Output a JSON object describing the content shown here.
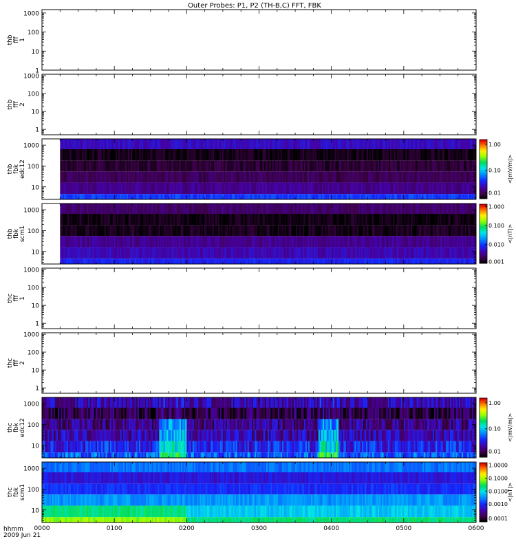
{
  "title": "Outer Probes: P1, P2 (TH-B,C) FFT, FBK",
  "colors": {
    "ink": "#000000"
  },
  "chart_data": [
    {
      "id": "thb-fff1",
      "type": "heatmap",
      "ylabel": [
        "thb",
        "fff",
        "1"
      ],
      "yscale": "log",
      "ylim": [
        1,
        1500
      ],
      "yticks": [
        1,
        10,
        100,
        1000
      ],
      "ytick_labels": [
        "1",
        "10",
        "100",
        "1000"
      ],
      "has_data": false,
      "colorbar": null
    },
    {
      "id": "thb-fff2",
      "type": "heatmap",
      "ylabel": [
        "thb",
        "fff",
        "2"
      ],
      "yscale": "log",
      "ylim": [
        0.5,
        1200
      ],
      "yticks": [
        1,
        10,
        100,
        1000
      ],
      "ytick_labels": [
        "1",
        "10",
        "100",
        "1000"
      ],
      "has_data": false,
      "colorbar": null
    },
    {
      "id": "thb-fbk-edc12",
      "type": "heatmap",
      "ylabel": [
        "thb",
        "fbk",
        "edc12"
      ],
      "yscale": "log",
      "ylim": [
        2.5,
        2000
      ],
      "yticks": [
        10,
        100,
        1000
      ],
      "ytick_labels": [
        "10",
        "100",
        "1000"
      ],
      "has_data": true,
      "data_start_hour": 0.25,
      "bands": [
        2048,
        512,
        128,
        32,
        8,
        2,
        2.5
      ],
      "band_levels": [
        0.22,
        0.03,
        0.06,
        0.1,
        0.16,
        0.32,
        0.62
      ],
      "colorbar": {
        "label": "<|mV/m|>",
        "ticks": [
          "1.00",
          "0.10",
          "0.01"
        ],
        "tick_pos": [
          0.92,
          0.48,
          0.1
        ]
      }
    },
    {
      "id": "thb-fbk-scm1",
      "type": "heatmap",
      "ylabel": [
        "thb",
        "fbk",
        "scm1"
      ],
      "yscale": "log",
      "ylim": [
        2.5,
        2000
      ],
      "yticks": [
        10,
        100,
        1000
      ],
      "ytick_labels": [
        "10",
        "100",
        "1000"
      ],
      "has_data": true,
      "data_start_hour": 0.25,
      "bands": [
        2048,
        512,
        128,
        32,
        8,
        2,
        2.5
      ],
      "band_levels": [
        0.12,
        0.02,
        0.03,
        0.16,
        0.2,
        0.28,
        0.5
      ],
      "colorbar": {
        "label": "<|nT|>",
        "ticks": [
          "1.000",
          "0.100",
          "0.010",
          "0.001"
        ],
        "tick_pos": [
          0.96,
          0.64,
          0.32,
          0.03
        ]
      }
    },
    {
      "id": "thc-fff1",
      "type": "heatmap",
      "ylabel": [
        "thc",
        "fff",
        "1"
      ],
      "yscale": "log",
      "ylim": [
        0.5,
        1200
      ],
      "yticks": [
        1,
        10,
        100,
        1000
      ],
      "ytick_labels": [
        "1",
        "10",
        "100",
        "1000"
      ],
      "has_data": false,
      "colorbar": null
    },
    {
      "id": "thc-fff2",
      "type": "heatmap",
      "ylabel": [
        "thc",
        "fff",
        "2"
      ],
      "yscale": "log",
      "ylim": [
        0.5,
        1200
      ],
      "yticks": [
        1,
        10,
        100,
        1000
      ],
      "ytick_labels": [
        "1",
        "10",
        "100",
        "1000"
      ],
      "has_data": false,
      "colorbar": null
    },
    {
      "id": "thc-fbk-edc12",
      "type": "heatmap",
      "ylabel": [
        "thc",
        "fbk",
        "edc12"
      ],
      "yscale": "log",
      "ylim": [
        2.5,
        2000
      ],
      "yticks": [
        10,
        100,
        1000
      ],
      "ytick_labels": [
        "10",
        "100",
        "1000"
      ],
      "has_data": true,
      "data_start_hour": 0,
      "bands": [
        2048,
        512,
        128,
        32,
        8,
        2,
        2.5
      ],
      "band_levels": [
        0.2,
        0.08,
        0.16,
        0.2,
        0.28,
        0.36,
        0.5
      ],
      "variability": 0.22,
      "colorbar": {
        "label": "<|mV/m|>",
        "ticks": [
          "1.00",
          "0.10",
          "0.01"
        ],
        "tick_pos": [
          0.92,
          0.48,
          0.1
        ]
      }
    },
    {
      "id": "thc-fbk-scm1",
      "type": "heatmap",
      "ylabel": [
        "thc",
        "fbk",
        "scm1"
      ],
      "yscale": "log",
      "ylim": [
        2.5,
        2000
      ],
      "yticks": [
        10,
        100,
        1000
      ],
      "ytick_labels": [
        "10",
        "100",
        "1000"
      ],
      "has_data": true,
      "data_start_hour": 0,
      "bands": [
        2048,
        512,
        128,
        32,
        8,
        2,
        2.5
      ],
      "band_levels": [
        0.38,
        0.25,
        0.3,
        0.42,
        0.48,
        0.6,
        0.7
      ],
      "colorbar": {
        "label": "<|nT|>",
        "ticks": [
          "1.0000",
          "0.1000",
          "0.0100",
          "0.0010",
          "0.0001"
        ],
        "tick_pos": [
          0.96,
          0.74,
          0.52,
          0.3,
          0.06
        ]
      }
    }
  ],
  "xaxis": {
    "label_line1": "hhmm",
    "label_line2": "2009 Jun 21",
    "xlim_hours": [
      0,
      6
    ],
    "ticks": [
      0,
      1,
      2,
      3,
      4,
      5,
      6
    ],
    "tick_labels": [
      "0000",
      "0100",
      "0200",
      "0300",
      "0400",
      "0500",
      "0600"
    ]
  }
}
